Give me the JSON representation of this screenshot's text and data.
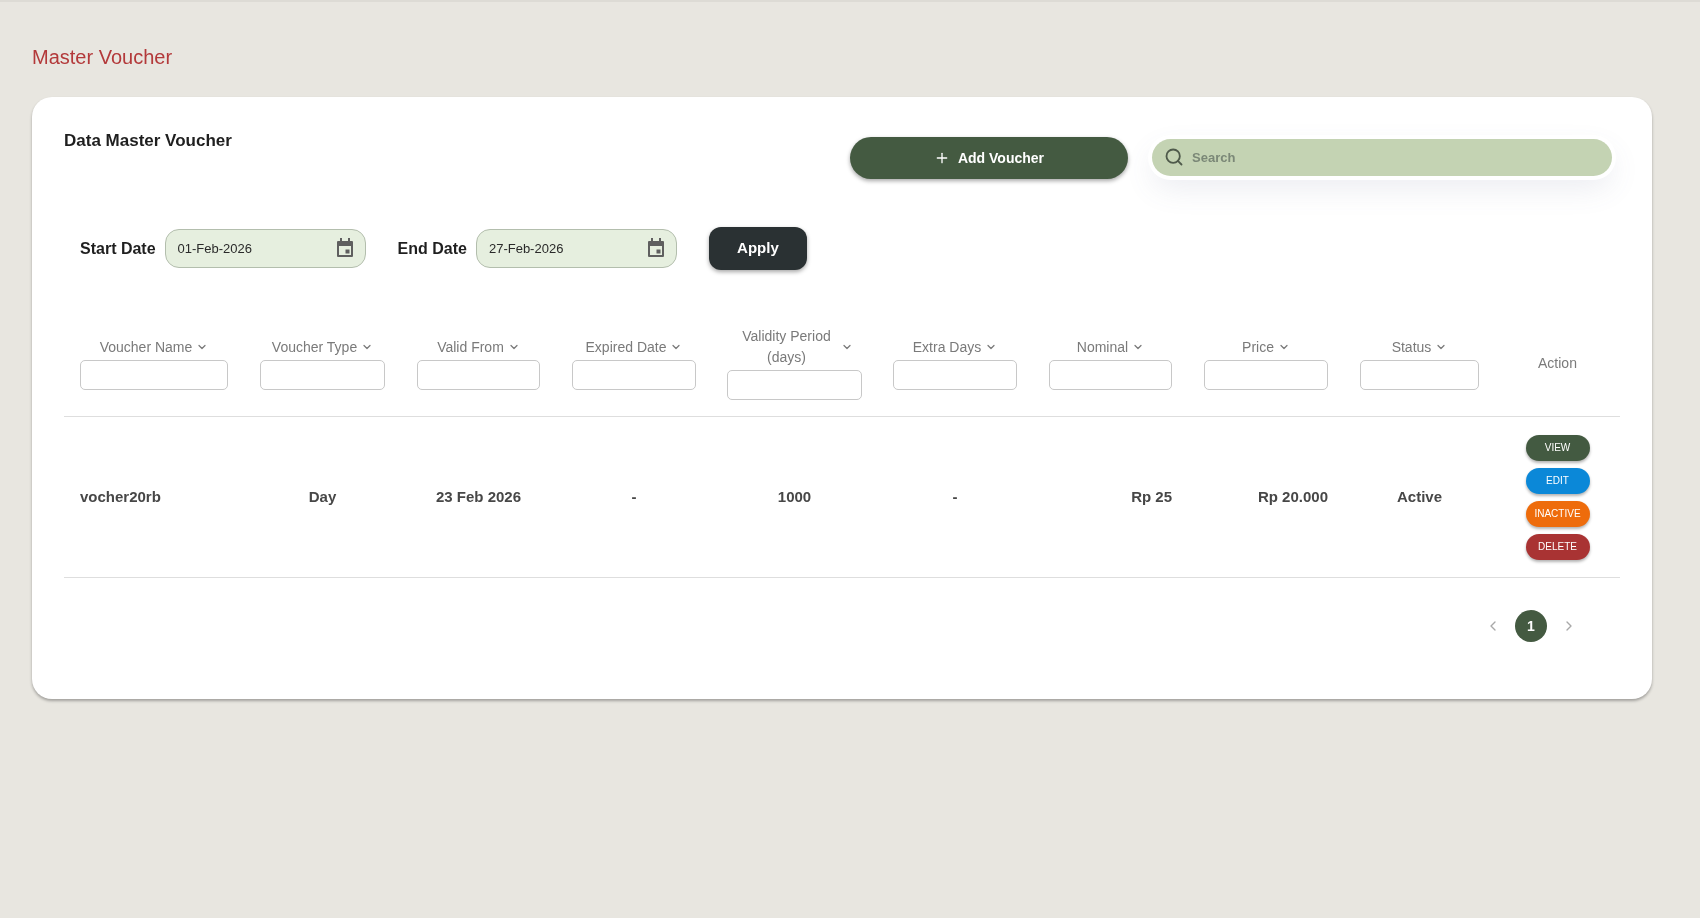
{
  "page_title": "Master Voucher",
  "card": {
    "title": "Data Master Voucher",
    "add_button": "Add Voucher",
    "search": {
      "placeholder": "Search"
    }
  },
  "filters": {
    "fields": [
      {
        "label": "Start Date",
        "value": "01-Feb-2026"
      },
      {
        "label": "End Date",
        "value": "27-Feb-2026"
      }
    ],
    "apply_button": "Apply"
  },
  "table": {
    "columns": [
      {
        "label": "Voucher Name",
        "kind": "filter"
      },
      {
        "label": "Voucher Type",
        "kind": "filter"
      },
      {
        "label": "Valid From",
        "kind": "filter"
      },
      {
        "label": "Expired Date",
        "kind": "filter"
      },
      {
        "label": "Validity Period (days)",
        "kind": "filter"
      },
      {
        "label": "Extra Days",
        "kind": "filter"
      },
      {
        "label": "Nominal",
        "kind": "filter"
      },
      {
        "label": "Price",
        "kind": "filter"
      },
      {
        "label": "Status",
        "kind": "filter"
      },
      {
        "label": "Action",
        "kind": "action"
      }
    ],
    "rows": [
      {
        "cells": [
          "vocher20rb",
          "Day",
          "23 Feb 2026",
          "-",
          "1000",
          "-",
          "Rp 25",
          "Rp 20.000",
          "Active"
        ],
        "actions": [
          {
            "label": "VIEW",
            "color": "#435a41"
          },
          {
            "label": "EDIT",
            "color": "#0b88d8"
          },
          {
            "label": "INACTIVE",
            "color": "#ee6c0c"
          },
          {
            "label": "DELETE",
            "color": "#a93333"
          }
        ]
      }
    ]
  },
  "pagination": {
    "pages": [
      {
        "label": "1",
        "selected": true
      }
    ]
  }
}
